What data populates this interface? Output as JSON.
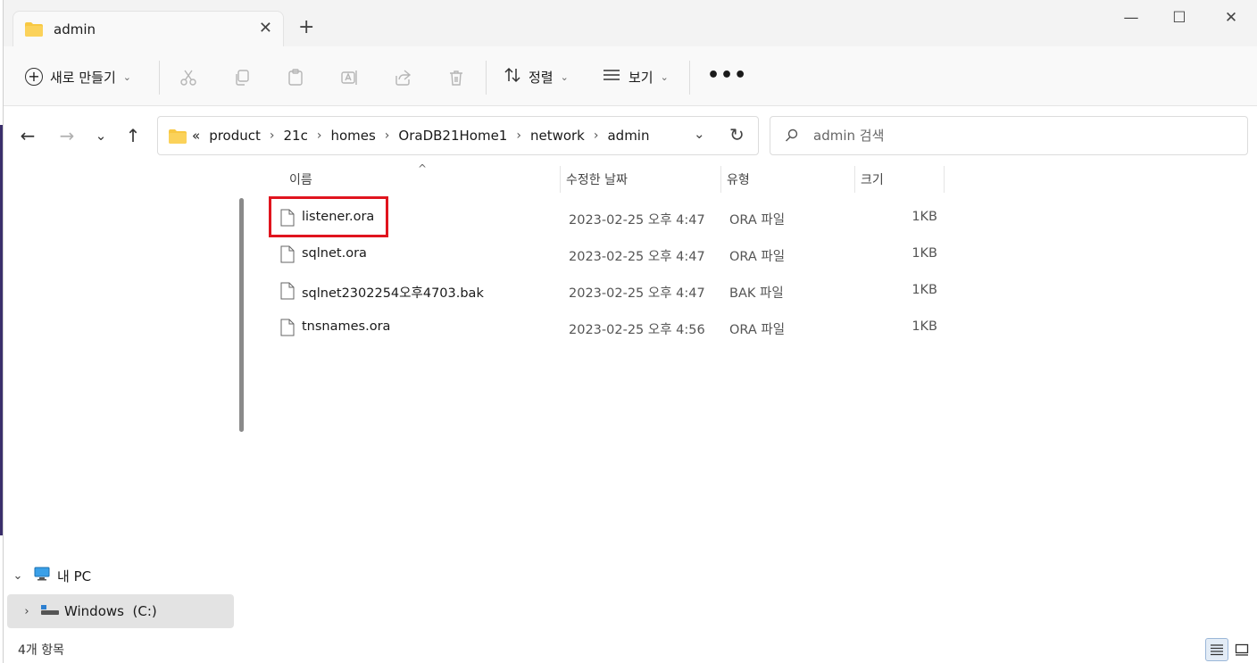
{
  "tab": {
    "title": "admin",
    "close": "✕",
    "new_tab": "+"
  },
  "window_controls": {
    "minimize": "—",
    "maximize": "☐",
    "close": "✕"
  },
  "toolbar": {
    "new_label": "새로 만들기",
    "sort_label": "정렬",
    "view_label": "보기",
    "more": "•••"
  },
  "address": {
    "overflow": "«",
    "crumbs": [
      "product",
      "21c",
      "homes",
      "OraDB21Home1",
      "network",
      "admin"
    ]
  },
  "search": {
    "placeholder": "admin 검색"
  },
  "columns": {
    "name": "이름",
    "date": "수정한 날짜",
    "type": "유형",
    "size": "크기"
  },
  "files": [
    {
      "name": "listener.ora",
      "date": "2023-02-25 오후 4:47",
      "type": "ORA 파일",
      "size": "1KB"
    },
    {
      "name": "sqlnet.ora",
      "date": "2023-02-25 오후 4:47",
      "type": "ORA 파일",
      "size": "1KB"
    },
    {
      "name": "sqlnet2302254오후4703.bak",
      "date": "2023-02-25 오후 4:47",
      "type": "BAK 파일",
      "size": "1KB"
    },
    {
      "name": "tnsnames.ora",
      "date": "2023-02-25 오후 4:56",
      "type": "ORA 파일",
      "size": "1KB"
    }
  ],
  "nav": {
    "this_pc": "내 PC",
    "drive": "Windows  (C:)"
  },
  "status": {
    "item_count": "4개 항목"
  },
  "colors": {
    "highlight": "#e0141e",
    "folder": "#f8c842"
  }
}
